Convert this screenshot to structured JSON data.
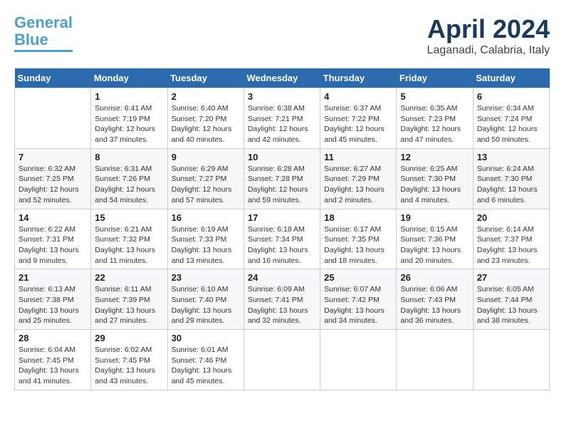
{
  "header": {
    "logo_line1": "General",
    "logo_line2": "Blue",
    "month_year": "April 2024",
    "location": "Laganadi, Calabria, Italy"
  },
  "weekdays": [
    "Sunday",
    "Monday",
    "Tuesday",
    "Wednesday",
    "Thursday",
    "Friday",
    "Saturday"
  ],
  "weeks": [
    [
      {
        "day": "",
        "info": ""
      },
      {
        "day": "1",
        "info": "Sunrise: 6:41 AM\nSunset: 7:19 PM\nDaylight: 12 hours\nand 37 minutes."
      },
      {
        "day": "2",
        "info": "Sunrise: 6:40 AM\nSunset: 7:20 PM\nDaylight: 12 hours\nand 40 minutes."
      },
      {
        "day": "3",
        "info": "Sunrise: 6:38 AM\nSunset: 7:21 PM\nDaylight: 12 hours\nand 42 minutes."
      },
      {
        "day": "4",
        "info": "Sunrise: 6:37 AM\nSunset: 7:22 PM\nDaylight: 12 hours\nand 45 minutes."
      },
      {
        "day": "5",
        "info": "Sunrise: 6:35 AM\nSunset: 7:23 PM\nDaylight: 12 hours\nand 47 minutes."
      },
      {
        "day": "6",
        "info": "Sunrise: 6:34 AM\nSunset: 7:24 PM\nDaylight: 12 hours\nand 50 minutes."
      }
    ],
    [
      {
        "day": "7",
        "info": "Sunrise: 6:32 AM\nSunset: 7:25 PM\nDaylight: 12 hours\nand 52 minutes."
      },
      {
        "day": "8",
        "info": "Sunrise: 6:31 AM\nSunset: 7:26 PM\nDaylight: 12 hours\nand 54 minutes."
      },
      {
        "day": "9",
        "info": "Sunrise: 6:29 AM\nSunset: 7:27 PM\nDaylight: 12 hours\nand 57 minutes."
      },
      {
        "day": "10",
        "info": "Sunrise: 6:28 AM\nSunset: 7:28 PM\nDaylight: 12 hours\nand 59 minutes."
      },
      {
        "day": "11",
        "info": "Sunrise: 6:27 AM\nSunset: 7:29 PM\nDaylight: 13 hours\nand 2 minutes."
      },
      {
        "day": "12",
        "info": "Sunrise: 6:25 AM\nSunset: 7:30 PM\nDaylight: 13 hours\nand 4 minutes."
      },
      {
        "day": "13",
        "info": "Sunrise: 6:24 AM\nSunset: 7:30 PM\nDaylight: 13 hours\nand 6 minutes."
      }
    ],
    [
      {
        "day": "14",
        "info": "Sunrise: 6:22 AM\nSunset: 7:31 PM\nDaylight: 13 hours\nand 9 minutes."
      },
      {
        "day": "15",
        "info": "Sunrise: 6:21 AM\nSunset: 7:32 PM\nDaylight: 13 hours\nand 11 minutes."
      },
      {
        "day": "16",
        "info": "Sunrise: 6:19 AM\nSunset: 7:33 PM\nDaylight: 13 hours\nand 13 minutes."
      },
      {
        "day": "17",
        "info": "Sunrise: 6:18 AM\nSunset: 7:34 PM\nDaylight: 13 hours\nand 16 minutes."
      },
      {
        "day": "18",
        "info": "Sunrise: 6:17 AM\nSunset: 7:35 PM\nDaylight: 13 hours\nand 18 minutes."
      },
      {
        "day": "19",
        "info": "Sunrise: 6:15 AM\nSunset: 7:36 PM\nDaylight: 13 hours\nand 20 minutes."
      },
      {
        "day": "20",
        "info": "Sunrise: 6:14 AM\nSunset: 7:37 PM\nDaylight: 13 hours\nand 23 minutes."
      }
    ],
    [
      {
        "day": "21",
        "info": "Sunrise: 6:13 AM\nSunset: 7:38 PM\nDaylight: 13 hours\nand 25 minutes."
      },
      {
        "day": "22",
        "info": "Sunrise: 6:11 AM\nSunset: 7:39 PM\nDaylight: 13 hours\nand 27 minutes."
      },
      {
        "day": "23",
        "info": "Sunrise: 6:10 AM\nSunset: 7:40 PM\nDaylight: 13 hours\nand 29 minutes."
      },
      {
        "day": "24",
        "info": "Sunrise: 6:09 AM\nSunset: 7:41 PM\nDaylight: 13 hours\nand 32 minutes."
      },
      {
        "day": "25",
        "info": "Sunrise: 6:07 AM\nSunset: 7:42 PM\nDaylight: 13 hours\nand 34 minutes."
      },
      {
        "day": "26",
        "info": "Sunrise: 6:06 AM\nSunset: 7:43 PM\nDaylight: 13 hours\nand 36 minutes."
      },
      {
        "day": "27",
        "info": "Sunrise: 6:05 AM\nSunset: 7:44 PM\nDaylight: 13 hours\nand 38 minutes."
      }
    ],
    [
      {
        "day": "28",
        "info": "Sunrise: 6:04 AM\nSunset: 7:45 PM\nDaylight: 13 hours\nand 41 minutes."
      },
      {
        "day": "29",
        "info": "Sunrise: 6:02 AM\nSunset: 7:45 PM\nDaylight: 13 hours\nand 43 minutes."
      },
      {
        "day": "30",
        "info": "Sunrise: 6:01 AM\nSunset: 7:46 PM\nDaylight: 13 hours\nand 45 minutes."
      },
      {
        "day": "",
        "info": ""
      },
      {
        "day": "",
        "info": ""
      },
      {
        "day": "",
        "info": ""
      },
      {
        "day": "",
        "info": ""
      }
    ]
  ]
}
